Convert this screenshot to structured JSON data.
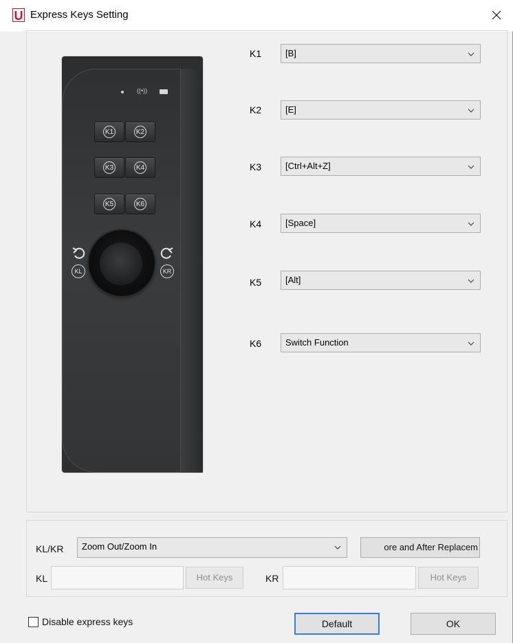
{
  "window": {
    "title": "Express Keys Setting",
    "logo_letter": "U",
    "accent_color": "#c8102e"
  },
  "device": {
    "keys": [
      "K1",
      "K2",
      "K3",
      "K4",
      "K5",
      "K6"
    ],
    "dial_left_label": "KL",
    "dial_right_label": "KR"
  },
  "key_settings": [
    {
      "label": "K1",
      "value": "[B]"
    },
    {
      "label": "K2",
      "value": "[E]"
    },
    {
      "label": "K3",
      "value": "[Ctrl+Alt+Z]"
    },
    {
      "label": "K4",
      "value": "[Space]"
    },
    {
      "label": "K5",
      "value": "[Alt]"
    },
    {
      "label": "K6",
      "value": "Switch Function"
    }
  ],
  "dial": {
    "label": "KL/KR",
    "value": "Zoom Out/Zoom In",
    "before_after_button": "ore and After Replacem",
    "kl_label": "KL",
    "kr_label": "KR",
    "kl_value": "",
    "kr_value": "",
    "hot_keys_label": "Hot Keys"
  },
  "footer": {
    "disable_label": "Disable express keys",
    "disable_checked": false,
    "default_button": "Default",
    "ok_button": "OK"
  },
  "icons": {
    "close": "close-icon",
    "dropdown": "chevron-down-icon",
    "rotate_left": "rotate-ccw-icon",
    "rotate_right": "rotate-cw-icon"
  }
}
